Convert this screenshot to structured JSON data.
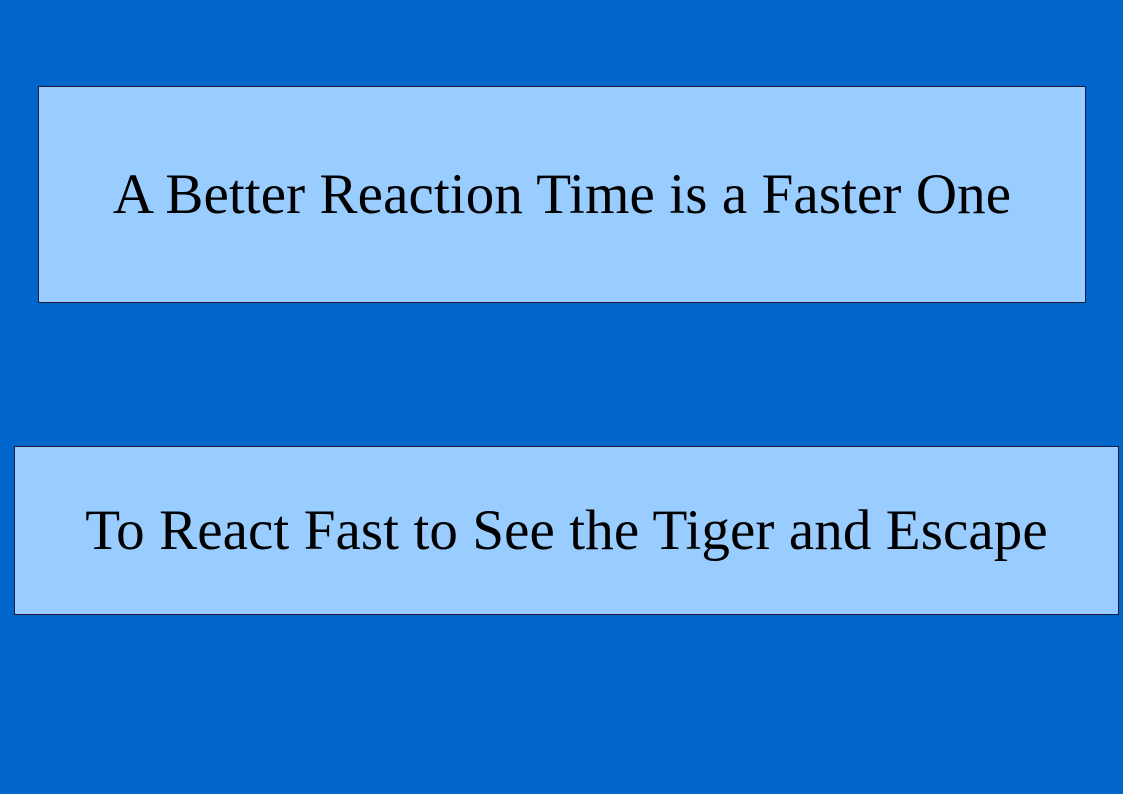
{
  "slide": {
    "background_color": "#0066cc",
    "box_color": "#99ccff",
    "headline": "A Better Reaction Time is a Faster One",
    "subheadline": "To React Fast to See the Tiger and Escape"
  }
}
